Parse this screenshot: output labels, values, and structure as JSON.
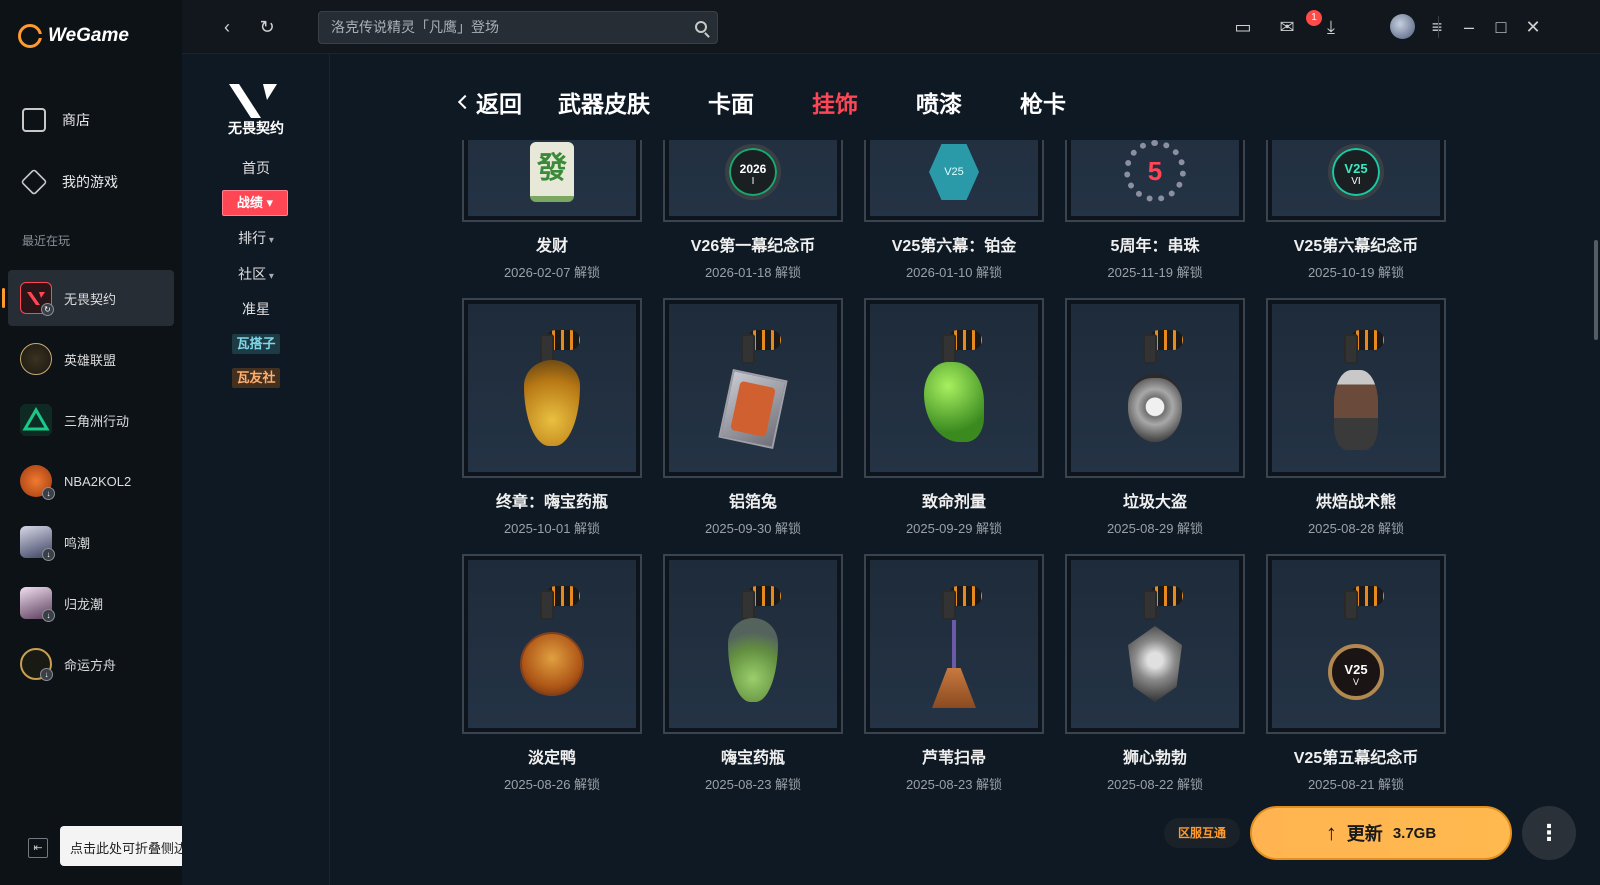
{
  "app": {
    "brand": "WeGame"
  },
  "sidebar": {
    "nav": [
      {
        "label": "商店",
        "icon": "shop-icon"
      },
      {
        "label": "我的游戏",
        "icon": "games-icon"
      }
    ],
    "recent_label": "最近在玩",
    "games": [
      {
        "label": "无畏契约",
        "color": "#ff4655"
      },
      {
        "label": "英雄联盟",
        "color": "#c8aa6e"
      },
      {
        "label": "三角洲行动",
        "color": "#19c98a"
      },
      {
        "label": "NBA2KOL2",
        "color": "#e0641e"
      },
      {
        "label": "鸣潮",
        "color": "#6a7aa8"
      },
      {
        "label": "归龙潮",
        "color": "#b0a0c8"
      },
      {
        "label": "命运方舟",
        "color": "#c8a050"
      }
    ],
    "collapse_tooltip": "点击此处可折叠侧边栏"
  },
  "topbar": {
    "search_placeholder": "洛克传说精灵「凡鹰」登场",
    "mail_count": "1"
  },
  "subnav": {
    "game_name": "无畏契约",
    "home": "首页",
    "record": "战绩",
    "rank": "排行",
    "community": "社区",
    "crosshair": "准星",
    "tag1": "瓦搭子",
    "tag2": "瓦友社"
  },
  "tabs": {
    "back": "返回",
    "items": [
      "武器皮肤",
      "卡面",
      "挂饰",
      "喷漆",
      "枪卡"
    ],
    "active": "挂饰"
  },
  "cards": [
    {
      "name": "发财",
      "date": "2026-02-07 解锁"
    },
    {
      "name": "V26第一幕纪念币",
      "date": "2026-01-18 解锁"
    },
    {
      "name": "V25第六幕：铂金",
      "date": "2026-01-10 解锁"
    },
    {
      "name": "5周年：串珠",
      "date": "2025-11-19 解锁"
    },
    {
      "name": "V25第六幕纪念币",
      "date": "2025-10-19 解锁"
    },
    {
      "name": "终章：嗨宝药瓶",
      "date": "2025-10-01 解锁"
    },
    {
      "name": "铝箔兔",
      "date": "2025-09-30 解锁"
    },
    {
      "name": "致命剂量",
      "date": "2025-09-29 解锁"
    },
    {
      "name": "垃圾大盗",
      "date": "2025-08-29 解锁"
    },
    {
      "name": "烘焙战术熊",
      "date": "2025-08-28 解锁"
    },
    {
      "name": "淡定鸭",
      "date": "2025-08-26 解锁"
    },
    {
      "name": "嗨宝药瓶",
      "date": "2025-08-23 解锁"
    },
    {
      "name": "芦苇扫帚",
      "date": "2025-08-23 解锁"
    },
    {
      "name": "狮心勃勃",
      "date": "2025-08-22 解锁"
    },
    {
      "name": "V25第五幕纪念币",
      "date": "2025-08-21 解锁"
    }
  ],
  "charm_text": {
    "fa": "發",
    "v26": "2026",
    "v26_sub": "I",
    "v25": "V25",
    "v25_sub": "VI",
    "five": "5",
    "v25_5": "V25",
    "v25_5_sub": "V"
  },
  "footer": {
    "region_tag": "区服互通",
    "update_label": "更新",
    "update_size": "3.7GB"
  }
}
